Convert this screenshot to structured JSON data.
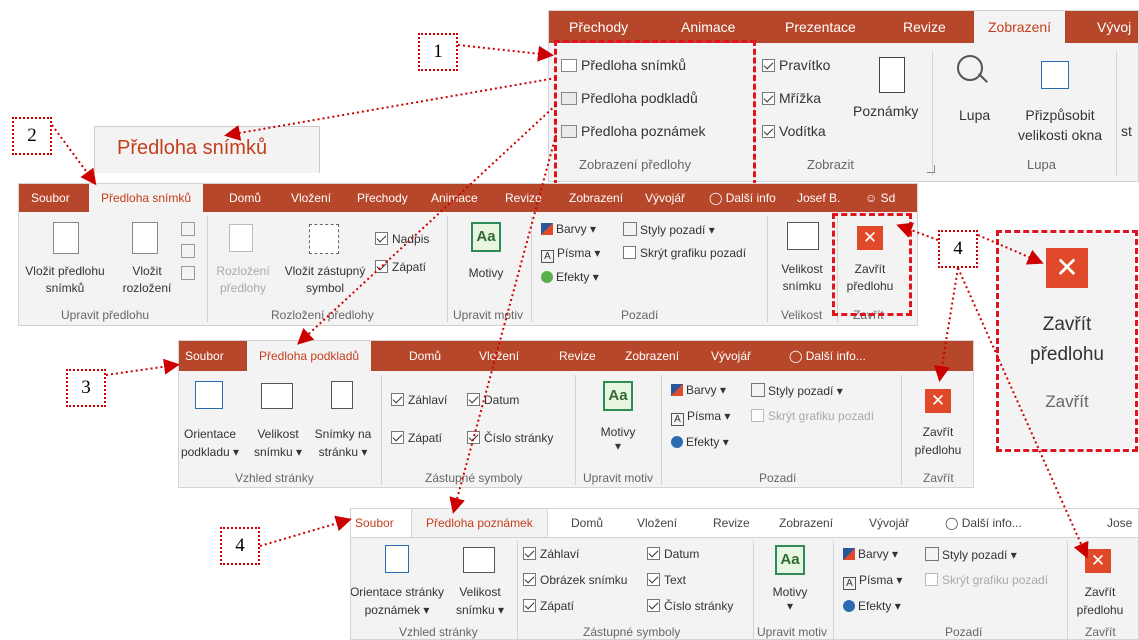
{
  "callouts": {
    "n1": "1",
    "n2": "2",
    "n3": "3",
    "n4a": "4",
    "n4b": "4"
  },
  "view_ribbon": {
    "tabs": [
      "Přechody",
      "Animace",
      "Prezentace",
      "Revize",
      "Zobrazení",
      "Vývoj"
    ],
    "active_tab": "Zobrazení",
    "master_views": [
      "Předloha snímků",
      "Předloha podkladů",
      "Předloha poznámek"
    ],
    "group_master": "Zobrazení předlohy",
    "show_items": [
      "Pravítko",
      "Mřížka",
      "Vodítka"
    ],
    "notes_label": "Poznámky",
    "group_show": "Zobrazit",
    "zoom_label": "Lupa",
    "fit_label_1": "Přizpůsobit",
    "fit_label_2": "velikosti okna",
    "group_zoom": "Lupa",
    "cut_label": "st"
  },
  "zoom_tab": {
    "label": "Předloha snímků"
  },
  "slide_master": {
    "tabs": [
      "Soubor",
      "Předloha snímků",
      "Domů",
      "Vložení",
      "Přechody",
      "Animace",
      "Revize",
      "Zobrazení",
      "Vývojář"
    ],
    "tell": "Další info",
    "user": "Josef B.",
    "share": "Sd",
    "insert_master_1": "Vložit předlohu",
    "insert_master_2": "snímků",
    "insert_layout_1": "Vložit",
    "insert_layout_2": "rozložení",
    "group_edit": "Upravit předlohu",
    "master_layout_1": "Rozložení",
    "master_layout_2": "předlohy",
    "placeholder_1": "Vložit zástupný",
    "placeholder_2": "symbol",
    "title_cb": "Nadpis",
    "footer_cb": "Zápatí",
    "group_layout": "Rozložení předlohy",
    "themes": "Motivy",
    "group_theme": "Upravit motiv",
    "colors": "Barvy",
    "fonts": "Písma",
    "effects": "Efekty",
    "bg_styles": "Styly pozadí",
    "hide_bg": "Skrýt grafiku pozadí",
    "group_bg": "Pozadí",
    "size_1": "Velikost",
    "size_2": "snímku",
    "group_size": "Velikost",
    "close_1": "Zavřít",
    "close_2": "předlohu",
    "group_close": "Zavřít"
  },
  "zoom_close": {
    "close_1": "Zavřít",
    "close_2": "předlohu",
    "group": "Zavřít"
  },
  "handout_master": {
    "tabs": [
      "Soubor",
      "Předloha podkladů",
      "Domů",
      "Vložení",
      "Revize",
      "Zobrazení",
      "Vývojář"
    ],
    "tell": "Další info...",
    "orient_1": "Orientace",
    "orient_2": "podkladu",
    "size_1": "Velikost",
    "size_2": "snímku",
    "per_page_1": "Snímky na",
    "per_page_2": "stránku",
    "group_page": "Vzhled stránky",
    "header": "Záhlaví",
    "date": "Datum",
    "footer": "Zápatí",
    "page_no": "Číslo stránky",
    "group_placeholders": "Zástupné symboly",
    "themes": "Motivy",
    "group_theme": "Upravit motiv",
    "colors": "Barvy",
    "fonts": "Písma",
    "effects": "Efekty",
    "bg_styles": "Styly pozadí",
    "hide_bg": "Skrýt grafiku pozadí",
    "group_bg": "Pozadí",
    "close_1": "Zavřít",
    "close_2": "předlohu",
    "group_close": "Zavřít"
  },
  "notes_master": {
    "tabs": [
      "Soubor",
      "Předloha poznámek",
      "Domů",
      "Vložení",
      "Revize",
      "Zobrazení",
      "Vývojář"
    ],
    "tell": "Další info...",
    "user": "Jose",
    "orient_1": "Orientace stránky",
    "orient_2": "poznámek",
    "size_1": "Velikost",
    "size_2": "snímku",
    "group_page": "Vzhled stránky",
    "header": "Záhlaví",
    "slide_image": "Obrázek snímku",
    "footer": "Zápatí",
    "date": "Datum",
    "text": "Text",
    "page_no": "Číslo stránky",
    "group_placeholders": "Zástupné symboly",
    "themes": "Motivy",
    "group_theme": "Upravit motiv",
    "colors": "Barvy",
    "fonts": "Písma",
    "effects": "Efekty",
    "bg_styles": "Styly pozadí",
    "hide_bg": "Skrýt grafiku pozadí",
    "group_bg": "Pozadí",
    "close_1": "Zavřít",
    "close_2": "předlohu",
    "group_close": "Zavřít"
  },
  "colors": {
    "accent": "#b7472a",
    "callout": "#e0141e",
    "close": "#e04a2a"
  }
}
